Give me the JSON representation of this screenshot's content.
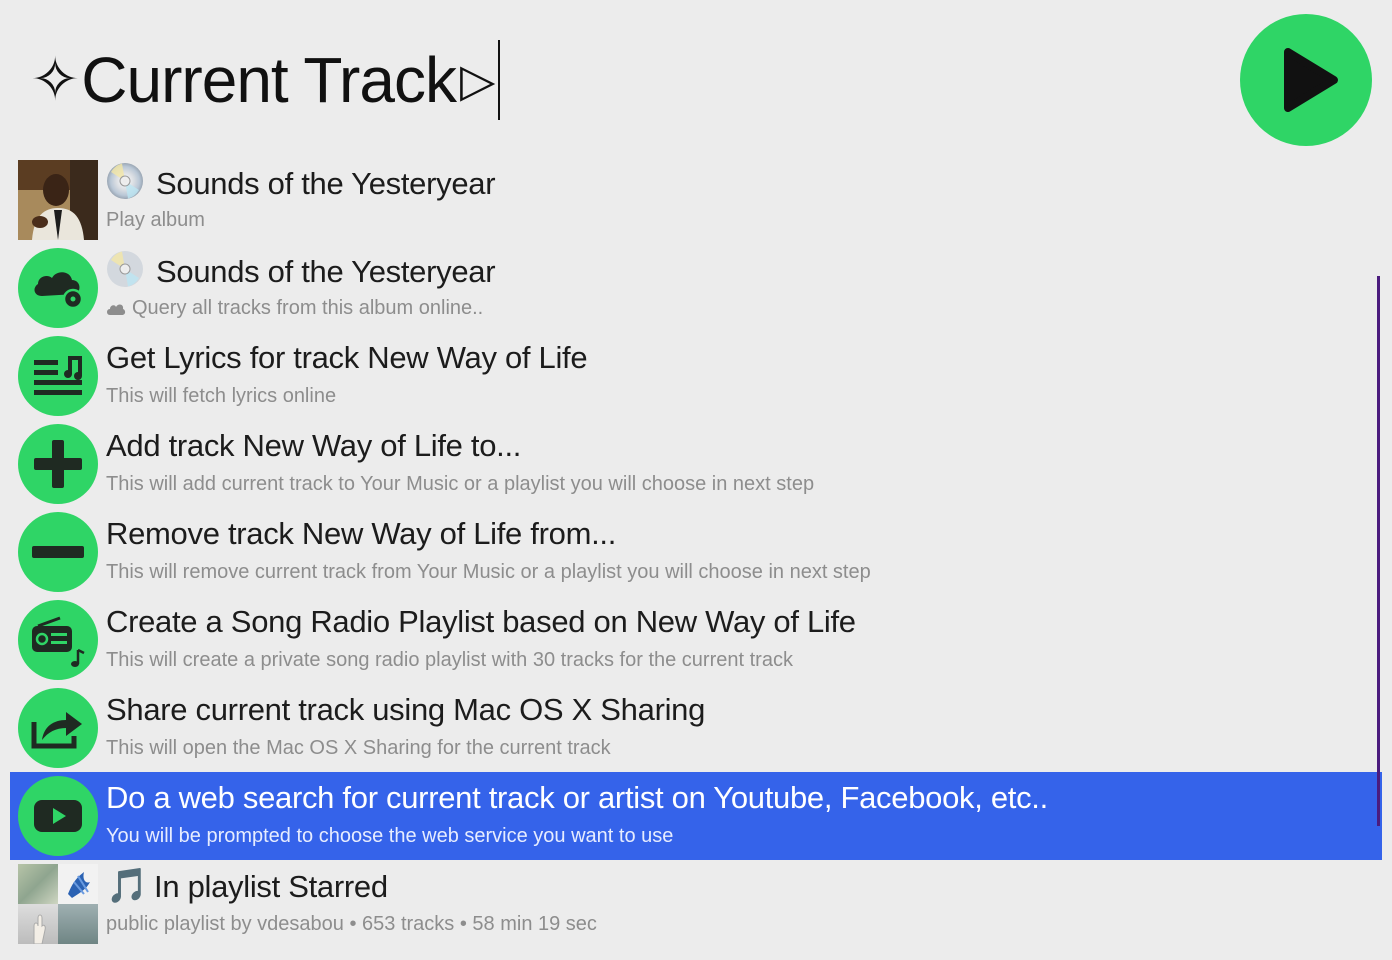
{
  "query": {
    "prefix_glyph": "✧",
    "text": "Current Track",
    "suffix_glyph": "▷"
  },
  "play_button": {
    "icon": "play-icon",
    "color": "#2fd566"
  },
  "accent": {
    "green": "#2fd566",
    "selection": "#3563ea"
  },
  "results": [
    {
      "icon": "album-cover",
      "title": "Sounds of the Yesteryear",
      "subtitle": "Play album",
      "title_emoji": "cd-icon"
    },
    {
      "icon": "cloud-disc-icon",
      "title": "Sounds of the Yesteryear",
      "subtitle": "Query all tracks from this album online..",
      "title_emoji": "cd-icon",
      "subtitle_emoji": "cloud-icon"
    },
    {
      "icon": "lyrics-icon",
      "title": "Get Lyrics for track New Way of Life",
      "subtitle": "This will fetch lyrics online"
    },
    {
      "icon": "plus-icon",
      "title": "Add track New Way of Life to...",
      "subtitle": "This will add current track to Your Music or a playlist you will choose in next step"
    },
    {
      "icon": "minus-icon",
      "title": "Remove track New Way of Life from...",
      "subtitle": "This will remove current track from Your Music or a playlist you will choose in next step"
    },
    {
      "icon": "radio-icon",
      "title": "Create a Song Radio Playlist based on New Way of Life",
      "subtitle": "This will create a private song radio playlist with 30 tracks for the current track"
    },
    {
      "icon": "share-icon",
      "title": "Share current track using Mac OS X Sharing",
      "subtitle": "This will open the Mac OS X Sharing for the current track"
    },
    {
      "icon": "youtube-icon",
      "title": "Do a web search for current track or artist on Youtube, Facebook, etc..",
      "subtitle": "You will be prompted to choose the web service you want to use",
      "selected": true
    },
    {
      "icon": "playlist-mosaic",
      "title": "In playlist Starred",
      "subtitle": "public playlist by vdesabou • 653 tracks • 58 min 19 sec",
      "title_emoji": "music-note-icon",
      "title_prefix": "🎵"
    }
  ]
}
